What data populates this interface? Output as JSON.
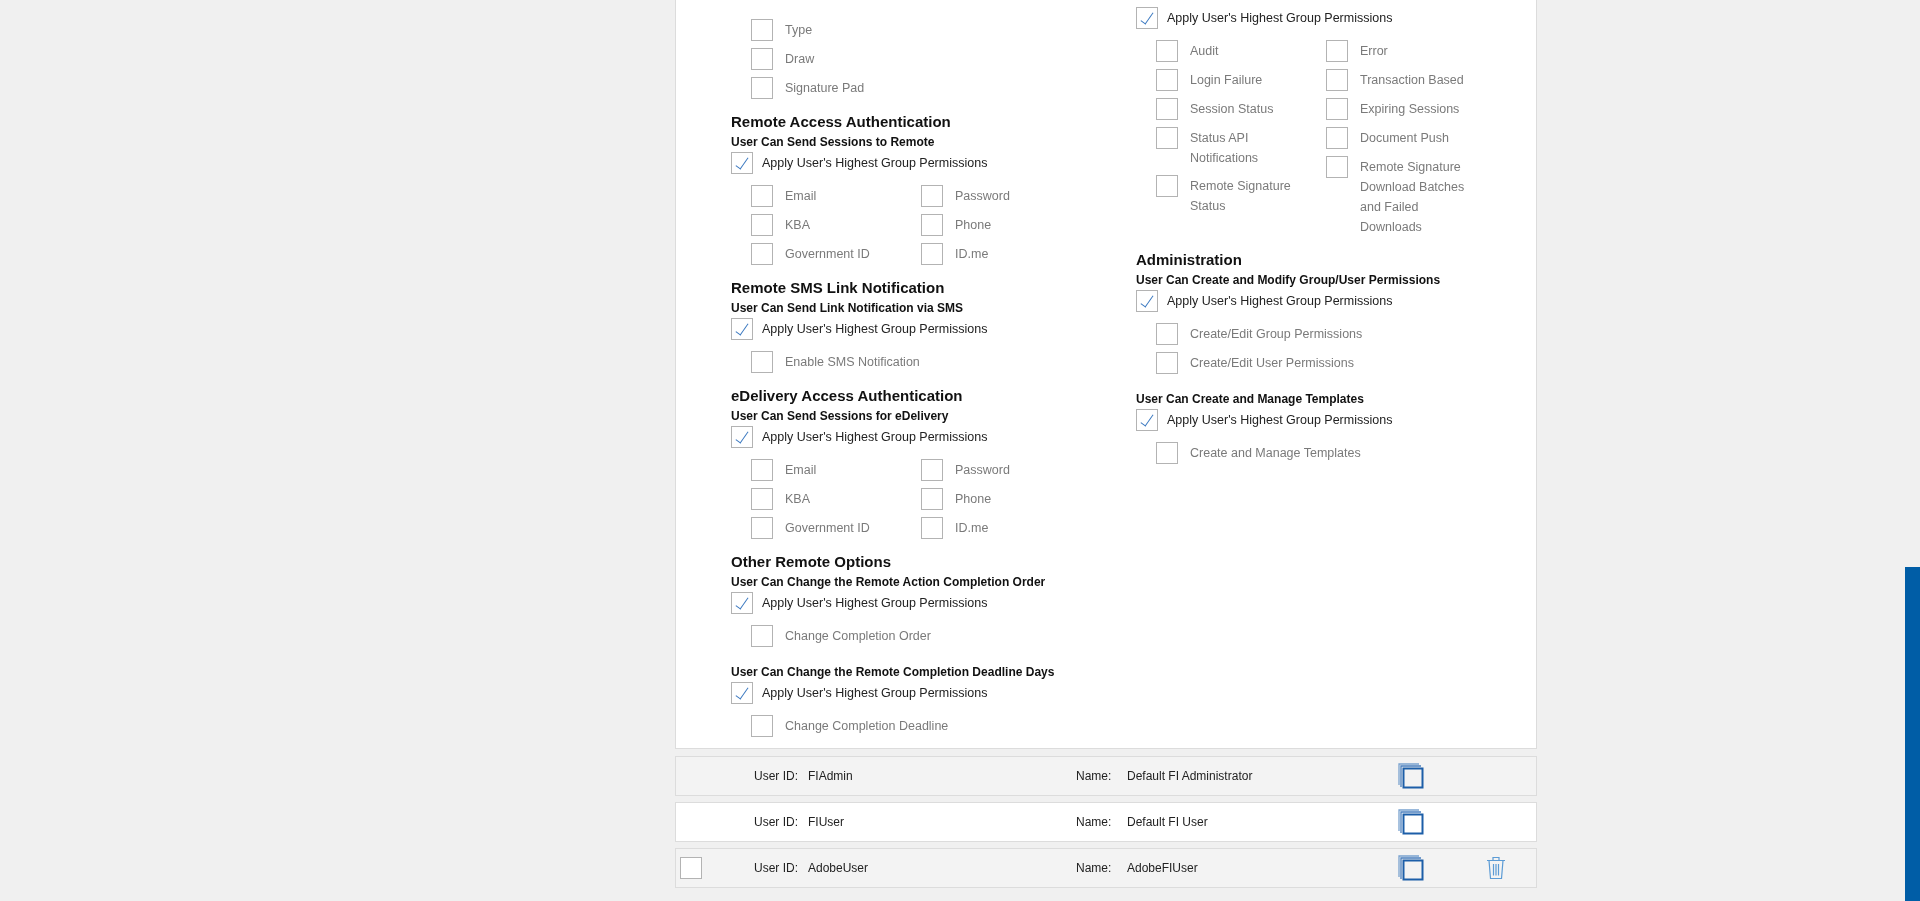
{
  "permission_columns": [
    {
      "items": [
        {
          "kind": "options-list",
          "options": [
            {
              "label": "Type",
              "checked": false
            },
            {
              "label": "Draw",
              "checked": false
            },
            {
              "label": "Signature Pad",
              "checked": false
            }
          ]
        },
        {
          "kind": "heading",
          "text": "Remote Access Authentication"
        },
        {
          "kind": "subheading",
          "text": "User Can Send Sessions to Remote"
        },
        {
          "kind": "apply",
          "label": "Apply User's Highest Group Permissions",
          "checked": true
        },
        {
          "kind": "options-columns",
          "option_columns": [
            {
              "options": [
                {
                  "label": "Email",
                  "checked": false
                },
                {
                  "label": "KBA",
                  "checked": false
                },
                {
                  "label": "Government ID",
                  "checked": false
                }
              ]
            },
            {
              "options": [
                {
                  "label": "Password",
                  "checked": false
                },
                {
                  "label": "Phone",
                  "checked": false
                },
                {
                  "label": "ID.me",
                  "checked": false
                }
              ]
            }
          ]
        },
        {
          "kind": "heading",
          "text": "Remote SMS Link Notification"
        },
        {
          "kind": "subheading",
          "text": "User Can Send Link Notification via SMS"
        },
        {
          "kind": "apply",
          "label": "Apply User's Highest Group Permissions",
          "checked": true
        },
        {
          "kind": "options-list",
          "options": [
            {
              "label": "Enable SMS Notification",
              "checked": false
            }
          ]
        },
        {
          "kind": "heading",
          "text": "eDelivery Access Authentication"
        },
        {
          "kind": "subheading",
          "text": "User Can Send Sessions for eDelivery"
        },
        {
          "kind": "apply",
          "label": "Apply User's Highest Group Permissions",
          "checked": true
        },
        {
          "kind": "options-columns",
          "option_columns": [
            {
              "options": [
                {
                  "label": "Email",
                  "checked": false
                },
                {
                  "label": "KBA",
                  "checked": false
                },
                {
                  "label": "Government ID",
                  "checked": false
                }
              ]
            },
            {
              "options": [
                {
                  "label": "Password",
                  "checked": false
                },
                {
                  "label": "Phone",
                  "checked": false
                },
                {
                  "label": "ID.me",
                  "checked": false
                }
              ]
            }
          ]
        },
        {
          "kind": "heading",
          "text": "Other Remote Options"
        },
        {
          "kind": "subheading",
          "text": "User Can Change the Remote Action Completion Order"
        },
        {
          "kind": "apply",
          "label": "Apply User's Highest Group Permissions",
          "checked": true
        },
        {
          "kind": "options-list",
          "options": [
            {
              "label": "Change Completion Order",
              "checked": false
            }
          ]
        },
        {
          "kind": "subheading",
          "text": "User Can Change the Remote Completion Deadline Days"
        },
        {
          "kind": "apply",
          "label": "Apply User's Highest Group Permissions",
          "checked": true
        },
        {
          "kind": "options-list",
          "options": [
            {
              "label": "Change Completion Deadline",
              "checked": false
            }
          ]
        }
      ]
    },
    {
      "items": [
        {
          "kind": "apply",
          "label": "Apply User's Highest Group Permissions",
          "checked": true
        },
        {
          "kind": "options-columns",
          "option_columns": [
            {
              "options": [
                {
                  "label": "Audit",
                  "checked": false
                },
                {
                  "label": "Login Failure",
                  "checked": false
                },
                {
                  "label": "Session Status",
                  "checked": false
                },
                {
                  "label": "Status API Notifications",
                  "checked": false
                },
                {
                  "label": "Remote Signature Status",
                  "checked": false
                }
              ]
            },
            {
              "options": [
                {
                  "label": "Error",
                  "checked": false
                },
                {
                  "label": "Transaction Based",
                  "checked": false
                },
                {
                  "label": "Expiring Sessions",
                  "checked": false
                },
                {
                  "label": "Document Push",
                  "checked": false
                },
                {
                  "label": "Remote Signature Download Batches and Failed Downloads",
                  "checked": false
                }
              ]
            }
          ]
        },
        {
          "kind": "heading",
          "text": "Administration"
        },
        {
          "kind": "subheading",
          "text": "User Can Create and Modify Group/User Permissions"
        },
        {
          "kind": "apply",
          "label": "Apply User's Highest Group Permissions",
          "checked": true
        },
        {
          "kind": "options-list",
          "options": [
            {
              "label": "Create/Edit Group Permissions",
              "checked": false
            },
            {
              "label": "Create/Edit User Permissions",
              "checked": false
            }
          ]
        },
        {
          "kind": "subheading",
          "text": "User Can Create and Manage Templates"
        },
        {
          "kind": "apply",
          "label": "Apply User's Highest Group Permissions",
          "checked": true
        },
        {
          "kind": "options-list",
          "options": [
            {
              "label": "Create and Manage Templates",
              "checked": false
            }
          ]
        }
      ]
    }
  ],
  "users": [
    {
      "user_id_label": "User ID:",
      "user_id": "FIAdmin",
      "name_label": "Name:",
      "name": "Default FI Administrator",
      "highlighted": true,
      "selectable": false,
      "deletable": false
    },
    {
      "user_id_label": "User ID:",
      "user_id": "FIUser",
      "name_label": "Name:",
      "name": "Default FI User",
      "highlighted": false,
      "selectable": false,
      "deletable": false
    },
    {
      "user_id_label": "User ID:",
      "user_id": "AdobeUser",
      "name_label": "Name:",
      "name": "AdobeFIUser",
      "highlighted": true,
      "selectable": true,
      "checked": false,
      "deletable": true
    }
  ]
}
